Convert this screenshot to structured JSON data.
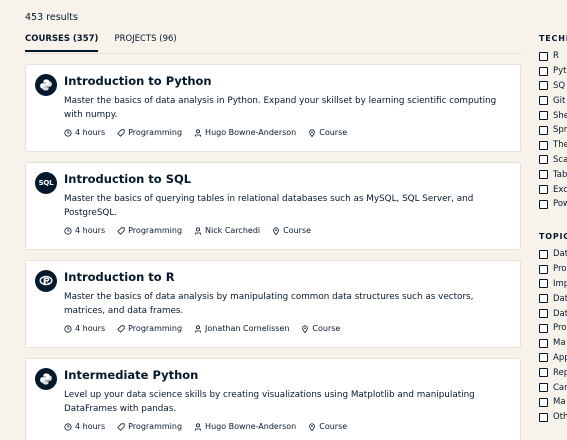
{
  "results_count": "453 results",
  "tabs": [
    {
      "label": "COURSES (357)",
      "active": true
    },
    {
      "label": "PROJECTS (96)",
      "active": false
    }
  ],
  "courses": [
    {
      "title": "Introduction to Python",
      "description": "Master the basics of data analysis in Python. Expand your skillset by learning scientific computing with numpy.",
      "duration": "4 hours",
      "category": "Programming",
      "instructor": "Hugo Bowne-Anderson",
      "type": "Course",
      "icon": "python-icon"
    },
    {
      "title": "Introduction to SQL",
      "description": "Master the basics of querying tables in relational databases such as MySQL, SQL Server, and PostgreSQL.",
      "duration": "4 hours",
      "category": "Programming",
      "instructor": "Nick Carchedi",
      "type": "Course",
      "icon": "sql-icon",
      "icon_text": "SQL"
    },
    {
      "title": "Introduction to R",
      "description": "Master the basics of data analysis by manipulating common data structures such as vectors, matrices, and data frames.",
      "duration": "4 hours",
      "category": "Programming",
      "instructor": "Jonathan Cornelissen",
      "type": "Course",
      "icon": "r-icon"
    },
    {
      "title": "Intermediate Python",
      "description": "Level up your data science skills by creating visualizations using Matplotlib and manipulating DataFrames with pandas.",
      "duration": "4 hours",
      "category": "Programming",
      "instructor": "Hugo Bowne-Anderson",
      "type": "Course",
      "icon": "python-icon"
    }
  ],
  "sidebar": {
    "technology_heading": "TECHI",
    "technology_items": [
      "R",
      "Pyt",
      "SQ",
      "Git",
      "She",
      "Spr",
      "The",
      "Sca",
      "Tab",
      "Exc",
      "Pow"
    ],
    "topic_heading": "TOPIC",
    "topic_items": [
      "Dat",
      "Pro",
      "Imp",
      "Dat",
      "Dat",
      "Pro",
      "Ma",
      "App",
      "Rep",
      "Car",
      "Ma",
      "Oth"
    ]
  }
}
